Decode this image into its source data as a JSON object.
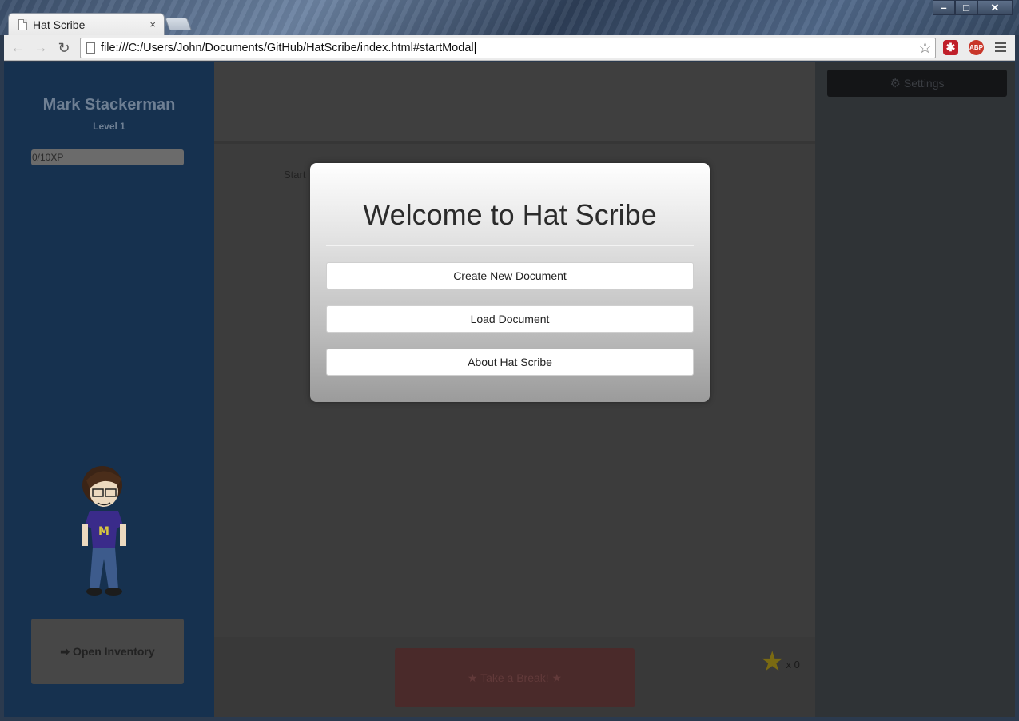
{
  "browser": {
    "tab_title": "Hat Scribe",
    "tab_close": "×",
    "url": "file:///C:/Users/John/Documents/GitHub/HatScribe/index.html#startModal",
    "window_controls": {
      "minimize": "–",
      "maximize": "□",
      "close": "✕"
    },
    "extensions": {
      "lastpass": "✱",
      "abp": "ABP"
    }
  },
  "sidebar": {
    "user_name": "Mark Stackerman",
    "level": "Level 1",
    "xp": "0/10XP",
    "inventory_label": "➡ Open Inventory"
  },
  "main": {
    "start_text": "Start",
    "break_label": "★ Take a Break! ★",
    "star_count": "x 0"
  },
  "right_panel": {
    "settings_label": "Settings"
  },
  "modal": {
    "title": "Welcome to Hat Scribe",
    "buttons": [
      "Create New Document",
      "Load Document",
      "About Hat Scribe"
    ]
  },
  "colors": {
    "sidebar_bg": "#16314f",
    "overlay_main": "#3c3c3c",
    "modal_top": "#ffffff",
    "modal_bottom": "#9b9b9b",
    "star": "#7a6a12"
  }
}
